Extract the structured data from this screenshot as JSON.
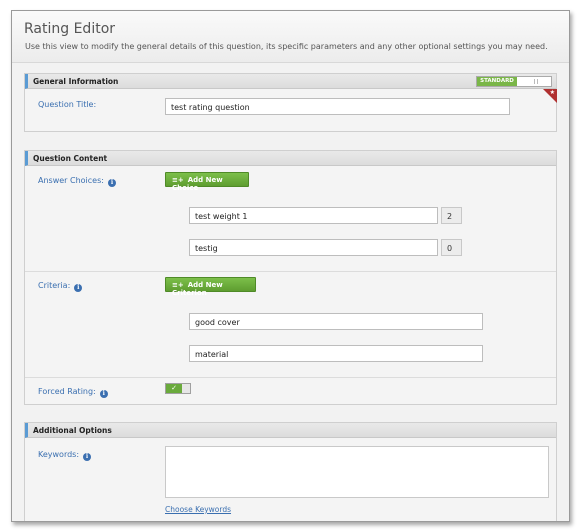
{
  "editor": {
    "title": "Rating Editor",
    "description": "Use this view to modify the general details of this question, its specific parameters and any other optional settings you may need."
  },
  "general": {
    "header": "General Information",
    "mode_toggle": {
      "label": "STANDARD",
      "on": true
    },
    "question_title_label": "Question Title:",
    "question_title_value": "test rating question",
    "corner_icon": "star-icon"
  },
  "content": {
    "header": "Question Content",
    "answer_choices_label": "Answer Choices:",
    "add_choice_label": "Add New Choice",
    "choices": [
      {
        "text": "test weight 1",
        "weight": "2"
      },
      {
        "text": "testig",
        "weight": "0"
      }
    ],
    "criteria_label": "Criteria:",
    "add_criterion_label": "Add New Criterion",
    "criteria": [
      {
        "text": "good cover"
      },
      {
        "text": "material"
      }
    ],
    "forced_rating_label": "Forced Rating:",
    "forced_rating_checked": true,
    "check_glyph": "✓"
  },
  "additional": {
    "header": "Additional Options",
    "keywords_label": "Keywords:",
    "keywords_value": "",
    "choose_keywords_link": "Choose Keywords"
  },
  "icons": {
    "info": "i",
    "add": "≡+"
  }
}
